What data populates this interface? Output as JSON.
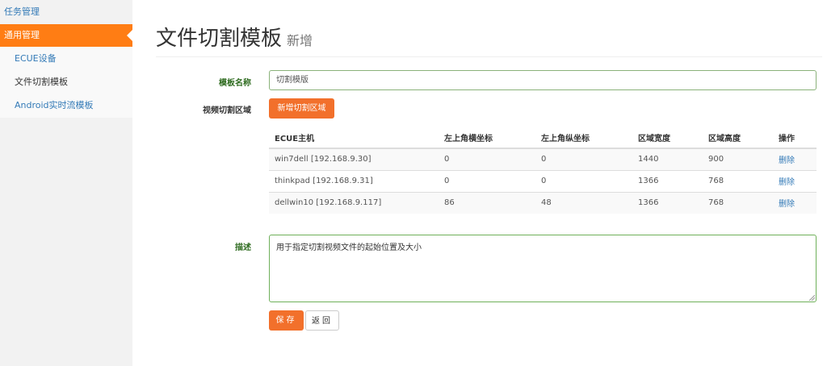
{
  "sidebar": {
    "top_item": "任务管理",
    "active_item": "通用管理",
    "sub_items": [
      "ECUE设备",
      "文件切割模板",
      "Android实时流模板"
    ]
  },
  "header": {
    "title": "文件切割模板",
    "subtitle": "新增"
  },
  "form": {
    "name_label": "模板名称",
    "name_value": "切割模版",
    "area_label": "视频切割区域",
    "add_button": "新增切割区域",
    "desc_label": "描述",
    "desc_value": "用于指定切割视频文件的起始位置及大小",
    "save_button": "保存",
    "back_button": "返回"
  },
  "table": {
    "headers": [
      "ECUE主机",
      "左上角横坐标",
      "左上角纵坐标",
      "区域宽度",
      "区域高度",
      "操作"
    ],
    "rows": [
      [
        "win7dell [192.168.9.30]",
        "0",
        "0",
        "1440",
        "900",
        "删除"
      ],
      [
        "thinkpad [192.168.9.31]",
        "0",
        "0",
        "1366",
        "768",
        "删除"
      ],
      [
        "dellwin10 [192.168.9.117]",
        "86",
        "48",
        "1366",
        "768",
        "删除"
      ]
    ]
  },
  "colors": {
    "accent": "#ff7d14",
    "button": "#f2702b",
    "link": "#337ab7",
    "label": "#2e6b1f"
  }
}
